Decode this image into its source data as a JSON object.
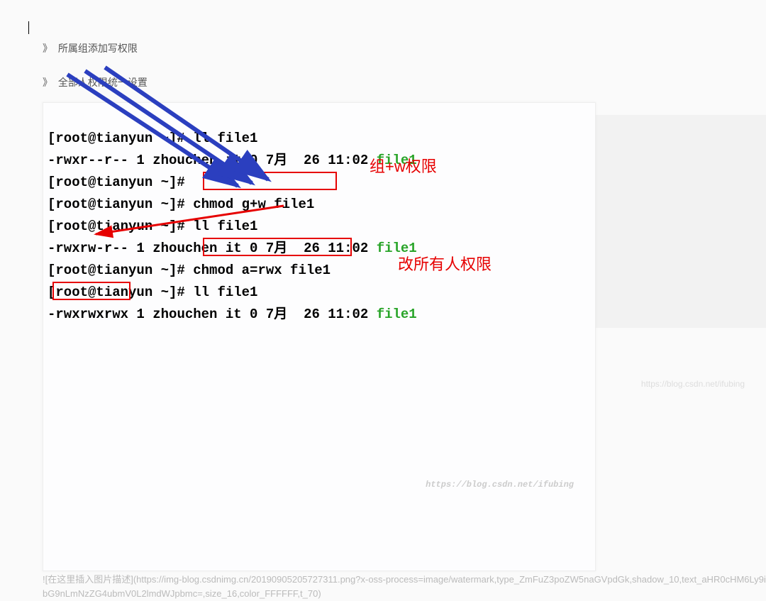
{
  "bullets": {
    "b1": "所属组添加写权限",
    "b2": "全部人权限统一设置"
  },
  "terminal": {
    "l1p": "[root@tianyun ~]# ",
    "l1c": "ll file1",
    "l2": "-rwxr--r-- 1 zhouchen it 0 7月  26 11:02 ",
    "l2f": "file1",
    "l3p": "[root@tianyun ~]#",
    "l4p": "[root@tianyun ~]# ",
    "l4c": "chmod g+w file1",
    "l5p": "[root@tianyun ~]# ",
    "l5c": "ll file1",
    "l6a": "-",
    "l6perm": "rwxrw-",
    "l6b": "r-- 1 zhouchen it 0 7月  26 11:02 ",
    "l6f": "file1",
    "l7p": "[root@tianyun ~]# ",
    "l7c": "chmod a=rwx file1",
    "l8p": "[root@tianyun ~]# ",
    "l8c": "ll file1",
    "l9a": "-",
    "l9perm": "rwxrwxrwx",
    "l9b": " 1 zhouchen it 0 7月  26 11:02 ",
    "l9f": "file1"
  },
  "annotations": {
    "a1": "组+w权限",
    "a2": "改所有人权限"
  },
  "caption": "![在这里插入图片描述](https://img-blog.csdnimg.cn/20190905205727311.png?x-oss-process=image/watermark,type_ZmFuZ3poZW5naGVpdGk,shadow_10,text_aHR0cHM6Ly9ibG9nLmNzZG4ubmV0L2lmdWJpbmc=,size_16,color_FFFFFF,t_70)",
  "watermark": "https://blog.csdn.net/ifubing",
  "watermark2": "https://blog.csdn.net/ifubing"
}
